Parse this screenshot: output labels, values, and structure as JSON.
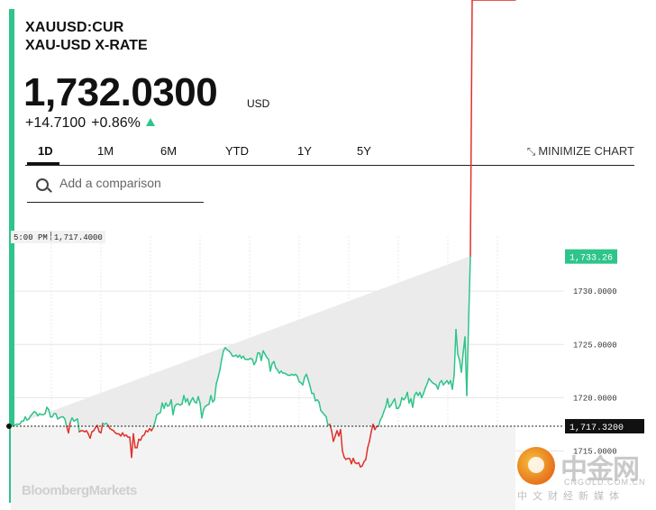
{
  "header": {
    "ticker": "XAUUSD:CUR",
    "name": "XAU-USD X-RATE",
    "price": "1,732.0300",
    "currency": "USD",
    "change_abs": "+14.7100",
    "change_pct": "+0.86%",
    "direction_icon": "up-triangle-icon"
  },
  "tabs": [
    "1D",
    "1M",
    "6M",
    "YTD",
    "1Y",
    "5Y"
  ],
  "active_tab": "1D",
  "minimize_label": "MINIMIZE CHART",
  "compare": {
    "placeholder": "Add a comparison"
  },
  "tooltip": {
    "time": "5:00 PM",
    "value": "1,717.4000"
  },
  "watermark": "BloombergMarkets",
  "cngold": {
    "name": "中金网",
    "url": "CNGOLD.COM.CN",
    "tagline": "中文财经新媒体"
  },
  "colors": {
    "up": "#2ec48a",
    "down": "#e0312b",
    "area_up": "#ebebeb"
  },
  "chart_data": {
    "type": "line",
    "baseline": 1717.32,
    "baseline_label": "1,717.3200",
    "last_label": "1,733.26",
    "last_value": 1733.26,
    "y_ticks": [
      1730,
      1725,
      1720,
      1715
    ],
    "y_tick_labels": [
      "1730.0000",
      "1725.0000",
      "1720.0000",
      "1715.0000"
    ],
    "ylim": [
      1712.5,
      1734.5
    ],
    "x": [
      0,
      2,
      4,
      6,
      8,
      10,
      12,
      14,
      16,
      18,
      20,
      22,
      24,
      26,
      28,
      30,
      32,
      34,
      36,
      38,
      40,
      42,
      44,
      46,
      48,
      50,
      52,
      54,
      56,
      58,
      60,
      62,
      64,
      66,
      68,
      70,
      72,
      74,
      76,
      78,
      80,
      82,
      84,
      86,
      88,
      90,
      92,
      94,
      96,
      98,
      100,
      102,
      104,
      106,
      108,
      110,
      112,
      114,
      116,
      118,
      120,
      122,
      124,
      126,
      128,
      130,
      132,
      134,
      136,
      138,
      140,
      142,
      144,
      146,
      148,
      150,
      152,
      154,
      156,
      158,
      160,
      162,
      164,
      166,
      168,
      170,
      172,
      174,
      176,
      178,
      180,
      182,
      184,
      186,
      188,
      190,
      192,
      194,
      196,
      198,
      200,
      202,
      204,
      206,
      208,
      210,
      212,
      214,
      216,
      218,
      220,
      222,
      224,
      226,
      228,
      230,
      232,
      234,
      236,
      238,
      240,
      242,
      244,
      246,
      248,
      250,
      252,
      254,
      256,
      258,
      260,
      262,
      264,
      266,
      268,
      270,
      272,
      274,
      276,
      278,
      280,
      282,
      284,
      286,
      288,
      290,
      292,
      294,
      296,
      298,
      300,
      302,
      304,
      306,
      308,
      310,
      312,
      314,
      316,
      318,
      320,
      322,
      324,
      326,
      328,
      330,
      332,
      334,
      336,
      338,
      340,
      342,
      344,
      346,
      348,
      350,
      352,
      354,
      356,
      358,
      360,
      362,
      364,
      366,
      368,
      370,
      372,
      374,
      376,
      378,
      380,
      382,
      384,
      386,
      388,
      390,
      392,
      394,
      396,
      398,
      400,
      402,
      404,
      406,
      408,
      410,
      412,
      414,
      416,
      418,
      420,
      422,
      424,
      426,
      428,
      430,
      432,
      434,
      436,
      438,
      440,
      442,
      444,
      446,
      448,
      450,
      452,
      454,
      456,
      458,
      460,
      462,
      464,
      466,
      468,
      470,
      472,
      474,
      476,
      478,
      480,
      482,
      484,
      486,
      488,
      490,
      492,
      494,
      496,
      498,
      500,
      502,
      504,
      506,
      508,
      510,
      512,
      514,
      516,
      518,
      520,
      522,
      524,
      526,
      528,
      530,
      532,
      534,
      536,
      538,
      540,
      542,
      544,
      546,
      548,
      550,
      552,
      554,
      556,
      558,
      560
    ],
    "y": [
      1717.3,
      1717.4,
      1717.4,
      1717.5,
      1717.5,
      1717.5,
      1717.8,
      1717.8,
      1718.2,
      1717.9,
      1718.0,
      1718.3,
      1718.5,
      1718.7,
      1718.6,
      1718.3,
      1718.5,
      1718.4,
      1718.4,
      1718.5,
      1719.1,
      1718.9,
      1718.2,
      1718.2,
      1718.5,
      1718.5,
      1718.0,
      1718.1,
      1718.2,
      1718.2,
      1718.0,
      1717.3,
      1716.7,
      1717.7,
      1718.1,
      1717.8,
      1717.9,
      1718.0,
      1716.8,
      1716.9,
      1716.9,
      1716.8,
      1716.9,
      1716.6,
      1716.2,
      1716.8,
      1716.9,
      1717.2,
      1717.4,
      1716.8,
      1716.7,
      1717.6,
      1717.5,
      1717.6,
      1717.4,
      1717.1,
      1717.0,
      1716.9,
      1716.7,
      1716.6,
      1716.6,
      1716.4,
      1716.7,
      1716.4,
      1716.5,
      1716.3,
      1716.3,
      1714.4,
      1716.6,
      1715.3,
      1715.3,
      1716.1,
      1716.0,
      1716.4,
      1716.5,
      1716.9,
      1716.8,
      1717.1,
      1716.9,
      1717.2,
      1717.7,
      1718.4,
      1718.5,
      1718.6,
      1719.5,
      1719.0,
      1719.5,
      1719.2,
      1719.3,
      1719.8,
      1718.4,
      1719.2,
      1719.4,
      1719.4,
      1719.3,
      1719.4,
      1720.2,
      1719.6,
      1719.9,
      1719.3,
      1719.7,
      1720.0,
      1719.6,
      1719.5,
      1720.1,
      1719.5,
      1718.1,
      1718.9,
      1719.2,
      1719.3,
      1719.4,
      1720.2,
      1719.6,
      1719.8,
      1721.3,
      1721.9,
      1722.6,
      1723.6,
      1724.4,
      1724.7,
      1724.5,
      1724.4,
      1724.2,
      1723.9,
      1723.9,
      1724.0,
      1723.8,
      1724.0,
      1723.7,
      1723.9,
      1723.6,
      1723.6,
      1723.6,
      1723.7,
      1723.6,
      1723.1,
      1723.4,
      1724.2,
      1724.2,
      1723.5,
      1724.4,
      1724.1,
      1723.8,
      1723.6,
      1722.5,
      1723.2,
      1723.4,
      1722.8,
      1722.6,
      1722.3,
      1722.5,
      1722.3,
      1722.3,
      1722.2,
      1722.1,
      1722.1,
      1722.2,
      1722.1,
      1722.2,
      1722.0,
      1721.5,
      1721.4,
      1721.2,
      1721.9,
      1722.2,
      1721.7,
      1721.1,
      1720.4,
      1720.4,
      1719.7,
      1719.8,
      1719.6,
      1718.8,
      1718.6,
      1718.4,
      1718.2,
      1717.4,
      1717.5,
      1716.9,
      1715.9,
      1716.4,
      1716.9,
      1716.4,
      1717.0,
      1715.0,
      1714.4,
      1714.2,
      1714.3,
      1714.3,
      1713.8,
      1714.3,
      1713.9,
      1713.8,
      1713.9,
      1713.5,
      1713.6,
      1714.0,
      1714.2,
      1715.3,
      1715.9,
      1716.8,
      1717.5,
      1717.0,
      1717.3,
      1717.3,
      1717.9,
      1718.2,
      1718.7,
      1719.1,
      1719.9,
      1719.1,
      1719.3,
      1719.6,
      1719.9,
      1719.0,
      1719.0,
      1719.3,
      1720.0,
      1719.8,
      1720.0,
      1720.5,
      1719.5,
      1719.9,
      1719.1,
      1720.2,
      1720.5,
      1720.2,
      1720.5,
      1720.0,
      1720.4,
      1720.9,
      1721.3,
      1721.8,
      1721.6,
      1721.4,
      1721.3,
      1721.2,
      1720.8,
      1721.4,
      1721.6,
      1721.2,
      1721.4,
      1721.6,
      1721.3,
      1721.6,
      1720.8,
      1722.1,
      1726.4,
      1724.1,
      1723.5,
      1722.4,
      1724.2,
      1725.7,
      1720.2,
      1727.0,
      1733.3
    ]
  }
}
